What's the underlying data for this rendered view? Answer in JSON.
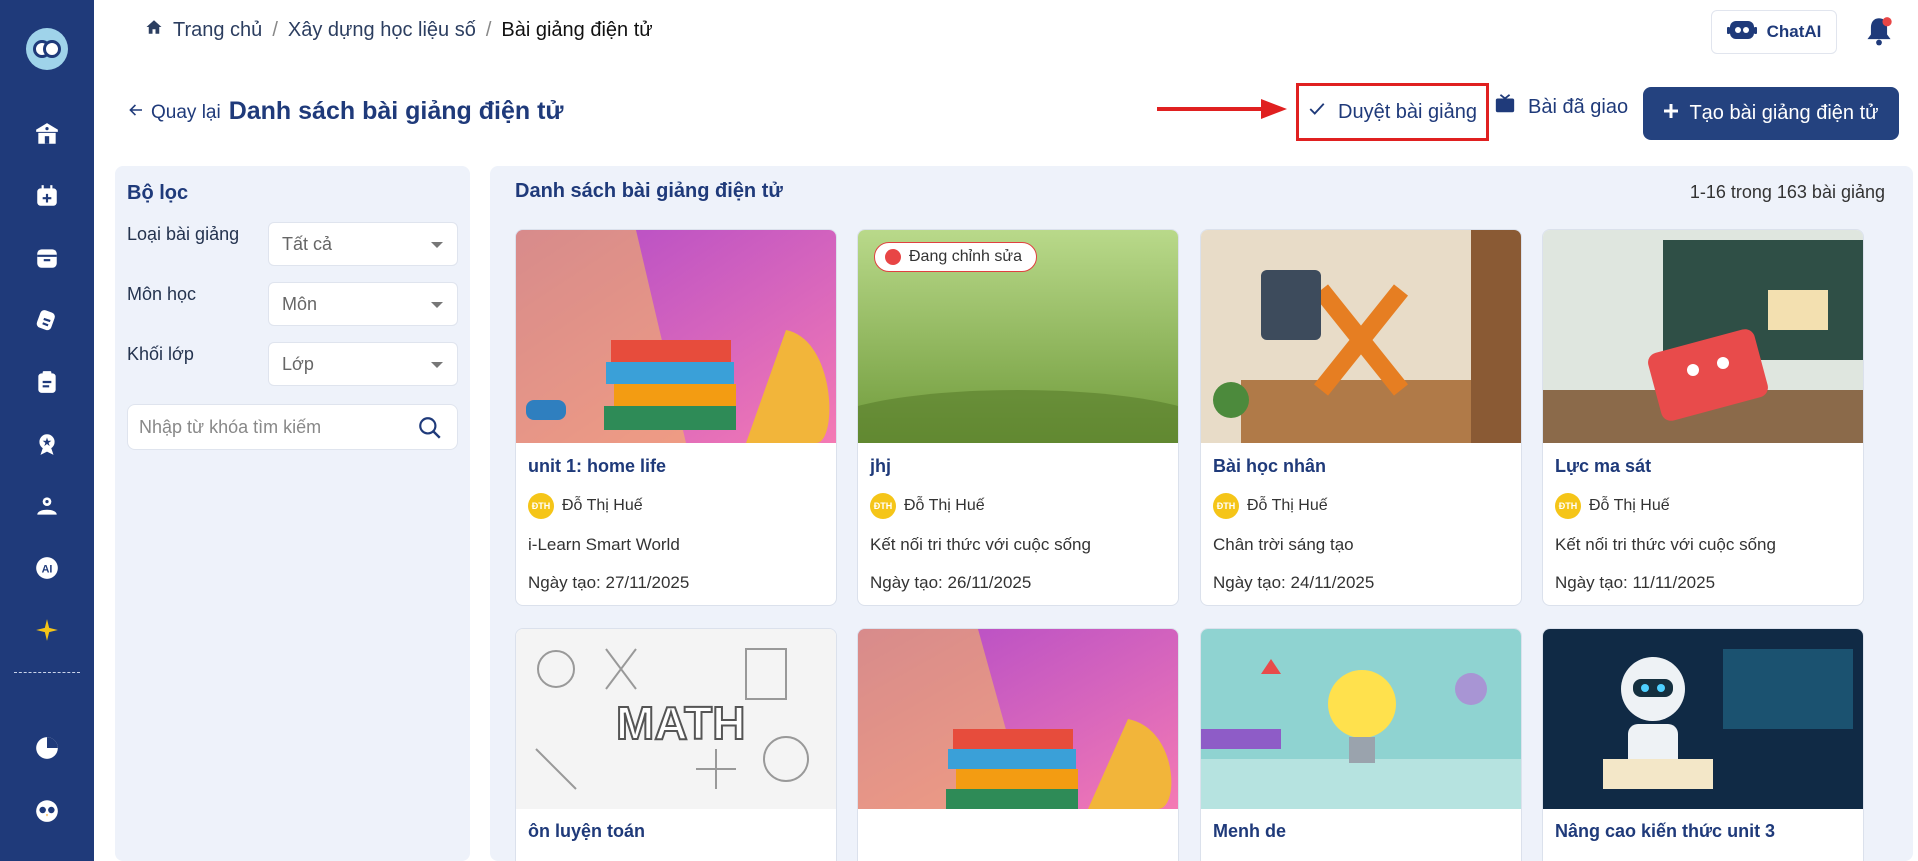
{
  "breadcrumb": {
    "home": "Trang chủ",
    "section": "Xây dựng học liệu số",
    "current": "Bài giảng điện tử"
  },
  "header": {
    "chatai_label": "ChatAI"
  },
  "page": {
    "back_label": "Quay lại",
    "title": "Danh sách bài giảng điện tử"
  },
  "actions": {
    "approve_label": "Duyệt bài giảng",
    "assigned_label": "Bài đã giao",
    "create_label": "Tạo bài giảng điện tử"
  },
  "filter": {
    "title": "Bộ lọc",
    "type_label": "Loại bài giảng",
    "type_value": "Tất cả",
    "subject_label": "Môn học",
    "subject_value": "Môn",
    "grade_label": "Khối lớp",
    "grade_value": "Lớp",
    "search_placeholder": "Nhập từ khóa tìm kiếm"
  },
  "list": {
    "title": "Danh sách bài giảng điện tử",
    "count": "1-16 trong 163 bài giảng",
    "cards": [
      {
        "title": "unit 1: home life",
        "author": "Đỗ Thị Huế",
        "initials": "ĐTH",
        "book": "i-Learn Smart World",
        "date": "Ngày tạo: 27/11/2025"
      },
      {
        "title": "jhj",
        "author": "Đỗ Thị Huế",
        "initials": "ĐTH",
        "book": "Kết nối tri thức với cuộc sống",
        "date": "Ngày tạo: 26/11/2025",
        "badge": "Đang chỉnh sửa"
      },
      {
        "title": "Bài học nhân",
        "author": "Đỗ Thị Huế",
        "initials": "ĐTH",
        "book": "Chân trời sáng tạo",
        "date": "Ngày tạo: 24/11/2025"
      },
      {
        "title": "Lực ma sát",
        "author": "Đỗ Thị Huế",
        "initials": "ĐTH",
        "book": "Kết nối tri thức với cuộc sống",
        "date": "Ngày tạo: 11/11/2025"
      },
      {
        "title": "ôn luyện toán"
      },
      {
        "title": ""
      },
      {
        "title": "Menh de"
      },
      {
        "title": "Nâng cao kiến thức unit 3"
      }
    ]
  },
  "colors": {
    "sidebar": "#1f3a7a",
    "primary": "#24427f",
    "highlight": "#e02020",
    "panel": "#eef2fa"
  }
}
